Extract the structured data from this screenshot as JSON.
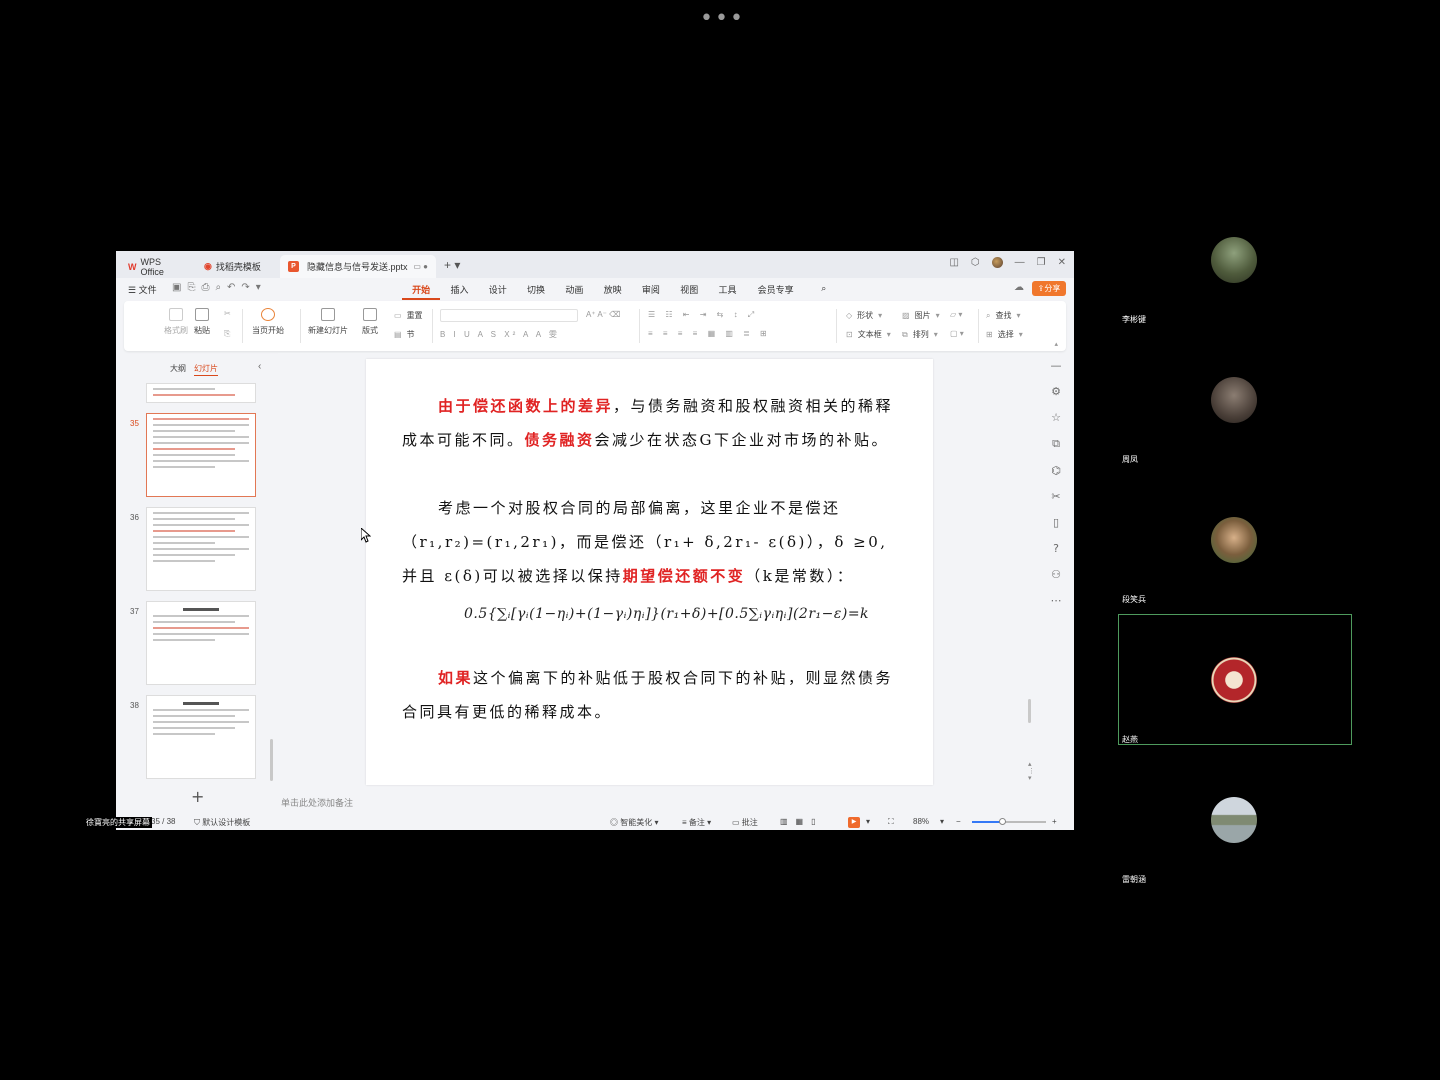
{
  "meeting": {
    "more_dots": "•••",
    "presenter_label": "徐寶亮的共享屏幕",
    "participants": [
      {
        "name": "李彬键"
      },
      {
        "name": "周凤"
      },
      {
        "name": "段笑兵"
      },
      {
        "name": "赵燕"
      },
      {
        "name": "雷朝涵"
      }
    ]
  },
  "wps": {
    "tabs": {
      "home": "WPS Office",
      "templates": "找稻壳模板",
      "document": "隐藏信息与信号发送.pptx"
    },
    "menubar": {
      "file": "☰ 文件",
      "items": [
        "开始",
        "插入",
        "设计",
        "切换",
        "动画",
        "放映",
        "审阅",
        "视图",
        "工具",
        "会员专享"
      ],
      "active": "开始",
      "share": "分享"
    },
    "ribbon": {
      "format_painter": "格式刷",
      "paste": "粘贴",
      "play_from_current": "当页开始",
      "new_slide": "新建幻灯片",
      "layout": "版式",
      "reset": "重置",
      "section": "节",
      "shape": "形状",
      "picture": "图片",
      "textbox": "文本框",
      "arrange": "排列",
      "find": "查找",
      "select": "选择"
    },
    "panel": {
      "outline_tab": "大纲",
      "slides_tab": "幻灯片",
      "slide_numbers": [
        "35",
        "36",
        "37",
        "38"
      ]
    },
    "slide": {
      "p1_red1": "由于偿还函数上的差异",
      "p1_rest1": "，与债务融资和股权融资相关的稀释成本可能不同。",
      "p1_red2": "债务融资",
      "p1_rest2": "会减少在状态G下企业对市场的补贴。",
      "p2_a": "考虑一个对股权合同的局部偏离，这里企业不是偿还（r₁,r₂)=(r₁,2r₁)，而是偿还（r₁+ δ,2r₁- ε(δ)），δ ≥0,并且 ε(δ)可以被选择以保持",
      "p2_red": "期望偿还额不变",
      "p2_b": "（k是常数）：",
      "formula": "0.5{∑ᵢ[γᵢ(1−ηᵢ)+(1−γᵢ)ηᵢ]}(r₁+δ)+[0.5∑ᵢγᵢηᵢ](2r₁−ε)=k",
      "p3_red": "如果",
      "p3_rest": "这个偏离下的补贴低于股权合同下的补贴，则显然债务合同具有更低的稀释成本。"
    },
    "notes_placeholder": "单击此处添加备注",
    "status": {
      "slide_counter": "35 / 38",
      "template": "默认设计模板",
      "smart_beautify": "智能美化",
      "notes": "备注",
      "comments": "批注",
      "zoom": "88%",
      "zoom_fraction": 0.4
    },
    "colors": {
      "accent": "#d9481b",
      "slide_red": "#e02323",
      "speaker_border": "#4e9a5d"
    }
  }
}
